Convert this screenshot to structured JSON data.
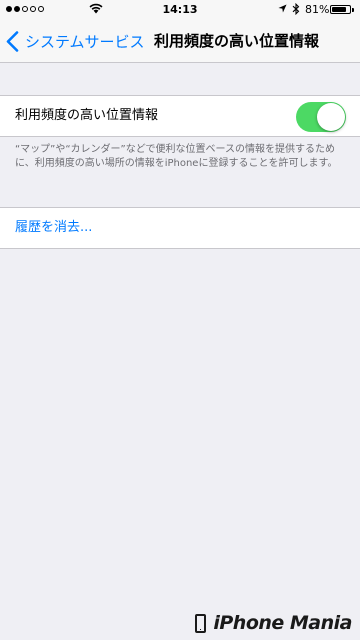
{
  "status_bar": {
    "signal_filled": 2,
    "signal_total": 5,
    "time": "14:13",
    "battery_percent": "81%",
    "battery_level": 0.81,
    "icons": [
      "wifi-icon",
      "location-arrow-icon",
      "bluetooth-icon",
      "battery-icon"
    ]
  },
  "nav": {
    "back_label": "システムサービス",
    "title": "利用頻度の高い位置情報"
  },
  "setting": {
    "label": "利用頻度の高い位置情報",
    "enabled": true,
    "switch_color": "#4cd964",
    "description": "“マップ”や“カレンダー”などで便利な位置ベースの情報を提供するために、利用頻度の高い場所の情報をiPhoneに登録することを許可します。"
  },
  "clear_history_label": "履歴を消去...",
  "watermark": {
    "text": "iPhone Mania"
  },
  "colors": {
    "accent": "#007aff",
    "background": "#efeff4",
    "bar": "#f7f7f7"
  }
}
